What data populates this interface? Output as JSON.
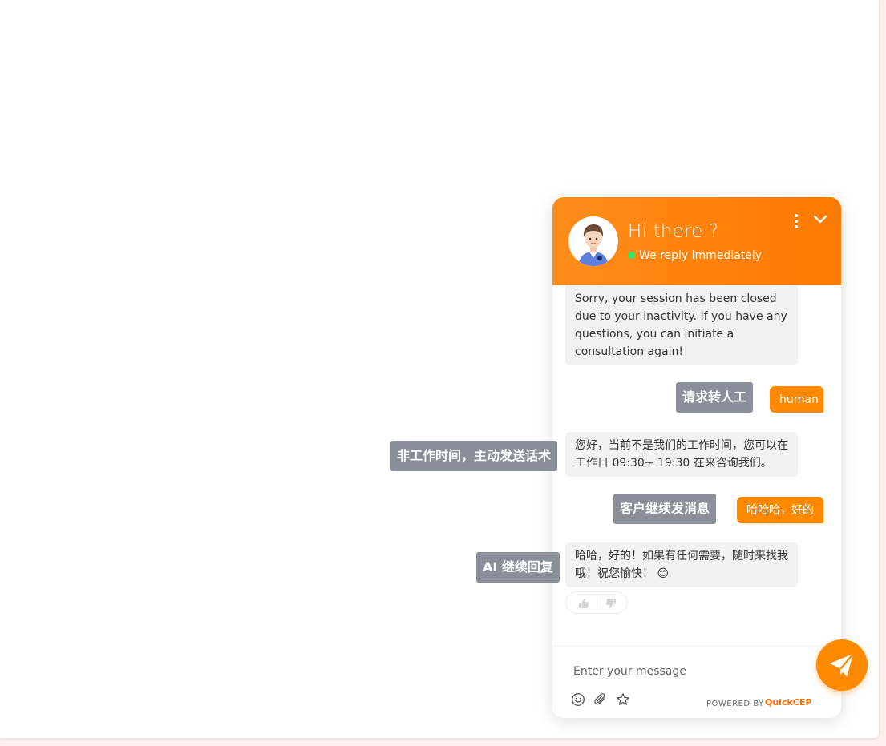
{
  "widget": {
    "header": {
      "title": "Hi there ?",
      "status": "We reply immediately"
    },
    "messages": [
      {
        "from": "agent",
        "text": "Sorry, your session has been closed due to your inactivity. If you have any questions, you can initiate a consultation again!"
      },
      {
        "from": "user",
        "text": "human"
      },
      {
        "from": "agent",
        "text": "您好，当前不是我们的工作时间，您可以在工作日 09:30~ 19:30 在来咨询我们。"
      },
      {
        "from": "user",
        "text": "哈哈哈，好的"
      },
      {
        "from": "agent",
        "text": "哈哈，好的！如果有任何需要，随时来找我哦！祝您愉快！",
        "emoji": "😊"
      }
    ],
    "input": {
      "placeholder": "Enter your message"
    },
    "footer": {
      "powered_by": "POWERED BY",
      "brand_part1": "Quick",
      "brand_part2": "CEP"
    }
  },
  "annotations": {
    "request_human": "请求转人工",
    "off_hours": "非工作时间，主动发送话术",
    "customer_continues": "客户继续发消息",
    "ai_continues": "AI 继续回复"
  },
  "colors": {
    "accent": "#ff8a00",
    "online": "#2ee86a",
    "annotation_bg": "#8a8f99",
    "agent_bubble": "#f2f2f3"
  },
  "icons": {
    "more": "more-vertical-icon",
    "collapse": "chevron-down-icon",
    "thumbs_up": "thumbs-up-icon",
    "thumbs_down": "thumbs-down-icon",
    "emoji": "smiley-icon",
    "attach": "paperclip-icon",
    "rate": "star-icon",
    "send": "paper-plane-icon"
  }
}
